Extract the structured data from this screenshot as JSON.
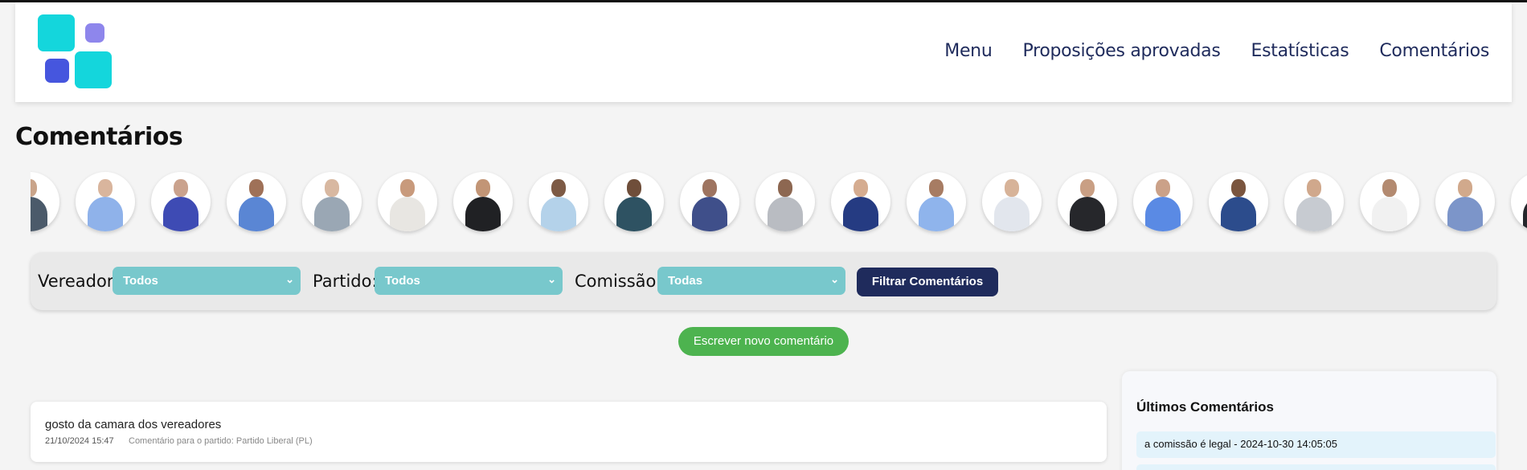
{
  "header": {
    "nav": [
      {
        "label": "Menu"
      },
      {
        "label": "Proposições aprovadas"
      },
      {
        "label": "Estatísticas"
      },
      {
        "label": "Comentários"
      }
    ]
  },
  "page": {
    "title": "Comentários"
  },
  "carousel": {
    "avatars": [
      {
        "shirt": "#4b5a6a",
        "skin": "#c9a48a"
      },
      {
        "shirt": "#8fb2ea",
        "skin": "#d9b59d"
      },
      {
        "shirt": "#3e4bb4",
        "skin": "#caa28d"
      },
      {
        "shirt": "#5a86d4",
        "skin": "#9f7158"
      },
      {
        "shirt": "#9aa7b4",
        "skin": "#d8b8a1"
      },
      {
        "shirt": "#e8e6e2",
        "skin": "#c89a7c"
      },
      {
        "shirt": "#202124",
        "skin": "#c29576"
      },
      {
        "shirt": "#b4d2ea",
        "skin": "#7d5a45"
      },
      {
        "shirt": "#2e5262",
        "skin": "#6f4e3a"
      },
      {
        "shirt": "#3f4f8a",
        "skin": "#9e7460"
      },
      {
        "shirt": "#b9bcc2",
        "skin": "#8d6751"
      },
      {
        "shirt": "#253b82",
        "skin": "#d5ac90"
      },
      {
        "shirt": "#8fb4ec",
        "skin": "#a77c63"
      },
      {
        "shirt": "#e2e6ed",
        "skin": "#d7b399"
      },
      {
        "shirt": "#26272b",
        "skin": "#c99f84"
      },
      {
        "shirt": "#5a8ae4",
        "skin": "#cba188"
      },
      {
        "shirt": "#2c4c8c",
        "skin": "#7a553e"
      },
      {
        "shirt": "#c7cbd1",
        "skin": "#d0a88c"
      },
      {
        "shirt": "#f1f1f1",
        "skin": "#b38a70"
      },
      {
        "shirt": "#7c95c9",
        "skin": "#d1a98c"
      },
      {
        "shirt": "#25272c",
        "skin": "#b58a6c"
      }
    ]
  },
  "filters": {
    "vereador_label": "Vereador:",
    "vereador_value": "Todos",
    "partido_label": "Partido:",
    "partido_value": "Todos",
    "comissao_label": "Comissão:",
    "comissao_value": "Todas",
    "submit_label": "Filtrar Comentários"
  },
  "actions": {
    "new_comment_label": "Escrever novo comentário"
  },
  "comments": [
    {
      "text": "gosto da camara dos vereadores",
      "date": "21/10/2024 15:47",
      "target": "Comentário para o partido: Partido Liberal (PL)"
    }
  ],
  "sidebar": {
    "title": "Últimos Comentários",
    "items": [
      {
        "text": "a comissão é legal - 2024-10-30 14:05:05"
      }
    ]
  },
  "colors": {
    "brand_navy": "#1f2b5c",
    "select_teal": "#78c8cc",
    "green_button": "#4db34f",
    "logo_cyan": "#14d6dc"
  }
}
